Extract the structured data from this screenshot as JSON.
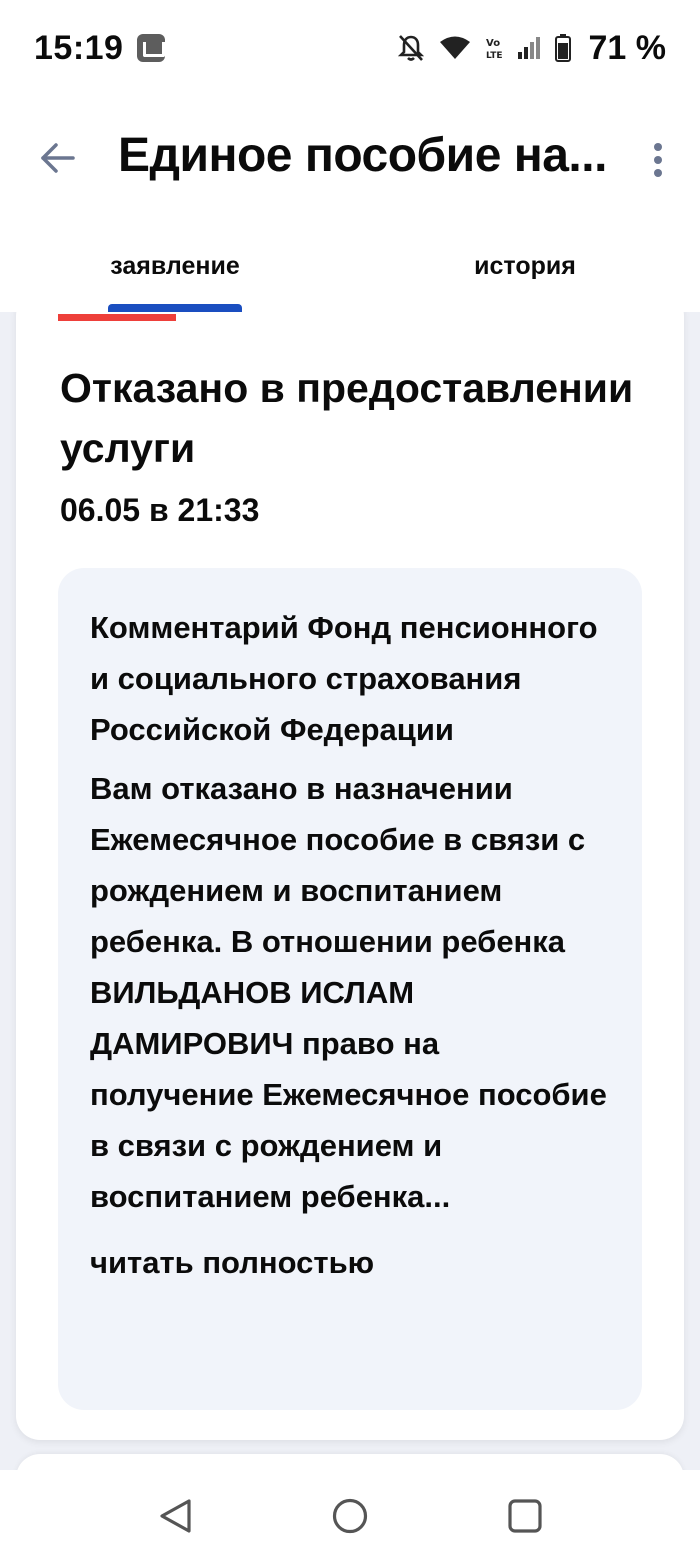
{
  "status_bar": {
    "time": "15:19",
    "battery": "71 %",
    "icons": [
      "app-notification-icon",
      "mute-icon",
      "wifi-icon",
      "volte-icon",
      "signal-icon",
      "battery-icon"
    ]
  },
  "header": {
    "title": "Единое пособие на...",
    "back_icon": "arrow-left-icon",
    "menu_icon": "more-vertical-icon"
  },
  "tabs": [
    {
      "label": "заявление",
      "active": true
    },
    {
      "label": "история",
      "active": false
    }
  ],
  "status_card": {
    "title": "Отказано в предоставлении услуги",
    "date": "06.05 в 21:33",
    "comment": {
      "heading": "Комментарий Фонд пенсионного и социального страхования Российской Федерации",
      "text": "Вам отказано в назначении Ежемесячное пособие в связи с рождением и воспитанием ребенка. В отношении ребенка ВИЛЬДАНОВ ИСЛАМ ДАМИРОВИЧ право на получение Ежемесячное пособие в связи с рождением и воспитанием ребенка...",
      "read_more": "читать полностью"
    }
  },
  "colors": {
    "accent_blue": "#1a4ec0",
    "accent_red": "#ee3f3a",
    "comment_bg": "#f1f4fa",
    "feed_bg": "#eef0f6",
    "icon_gray": "#6b7690"
  },
  "nav_bar": {
    "icons": [
      "nav-back-icon",
      "nav-home-icon",
      "nav-recents-icon"
    ]
  }
}
